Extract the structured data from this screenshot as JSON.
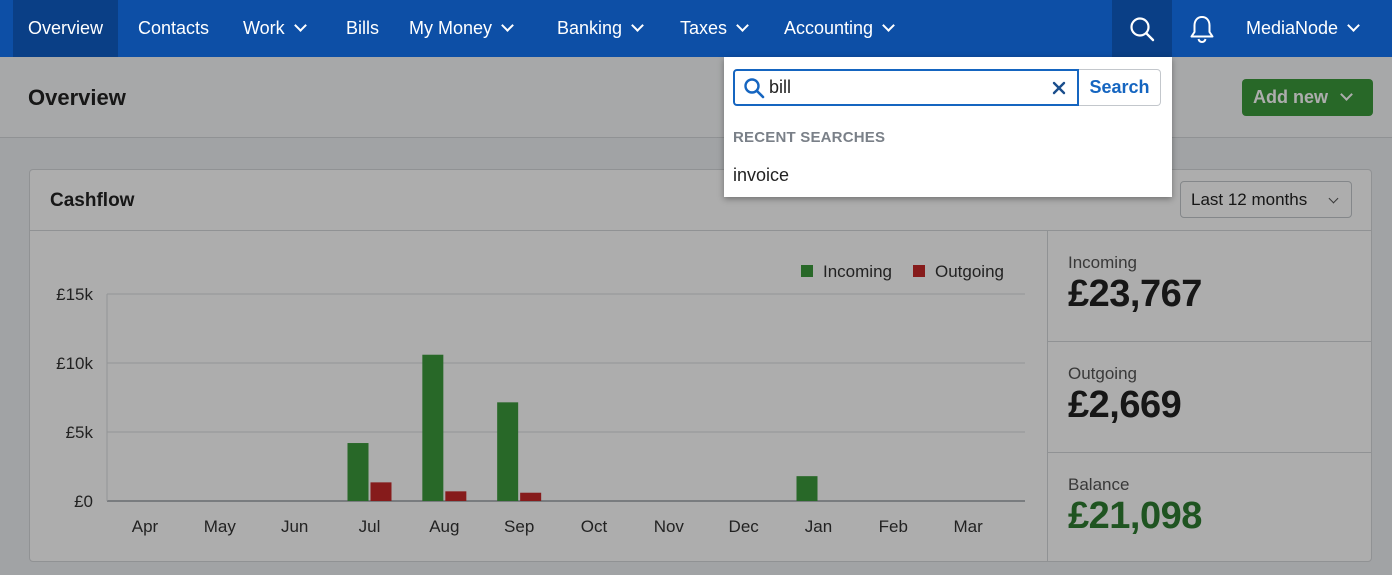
{
  "nav": {
    "items": [
      {
        "label": "Overview",
        "dropdown": false
      },
      {
        "label": "Contacts",
        "dropdown": false
      },
      {
        "label": "Work",
        "dropdown": true
      },
      {
        "label": "Bills",
        "dropdown": false
      },
      {
        "label": "My Money",
        "dropdown": true
      },
      {
        "label": "Banking",
        "dropdown": true
      },
      {
        "label": "Taxes",
        "dropdown": true
      },
      {
        "label": "Accounting",
        "dropdown": true
      }
    ],
    "account_name": "MediaNode",
    "icons": [
      "search-icon",
      "bell-icon"
    ]
  },
  "page": {
    "title": "Overview",
    "add_new_label": "Add new"
  },
  "search": {
    "value": "bill",
    "button_label": "Search",
    "recent_label": "RECENT SEARCHES",
    "recent_items": [
      "invoice"
    ]
  },
  "cashflow": {
    "title": "Cashflow",
    "period": "Last 12 months",
    "stats": [
      {
        "label": "Incoming",
        "value": "£23,767",
        "color": "#222222"
      },
      {
        "label": "Outgoing",
        "value": "£2,669",
        "color": "#222222"
      },
      {
        "label": "Balance",
        "value": "£21,098",
        "color": "#2e7d32"
      }
    ]
  },
  "colors": {
    "nav": "#0d4fa6",
    "incoming": "#3c9a3c",
    "outgoing": "#c62828",
    "accent": "#1565c0"
  },
  "chart_data": {
    "type": "bar",
    "categories": [
      "Apr",
      "May",
      "Jun",
      "Jul",
      "Aug",
      "Sep",
      "Oct",
      "Nov",
      "Dec",
      "Jan",
      "Feb",
      "Mar"
    ],
    "series": [
      {
        "name": "Incoming",
        "color": "#3c9a3c",
        "values": [
          0,
          0,
          0,
          4200,
          10600,
          7150,
          0,
          0,
          0,
          1800,
          0,
          0
        ]
      },
      {
        "name": "Outgoing",
        "color": "#c62828",
        "values": [
          0,
          0,
          0,
          1350,
          700,
          600,
          0,
          0,
          0,
          0,
          0,
          0
        ]
      }
    ],
    "yticks": [
      "£0",
      "£5k",
      "£10k",
      "£15k"
    ],
    "ylim": [
      0,
      15000
    ],
    "grid": true,
    "legend": "top-right"
  }
}
